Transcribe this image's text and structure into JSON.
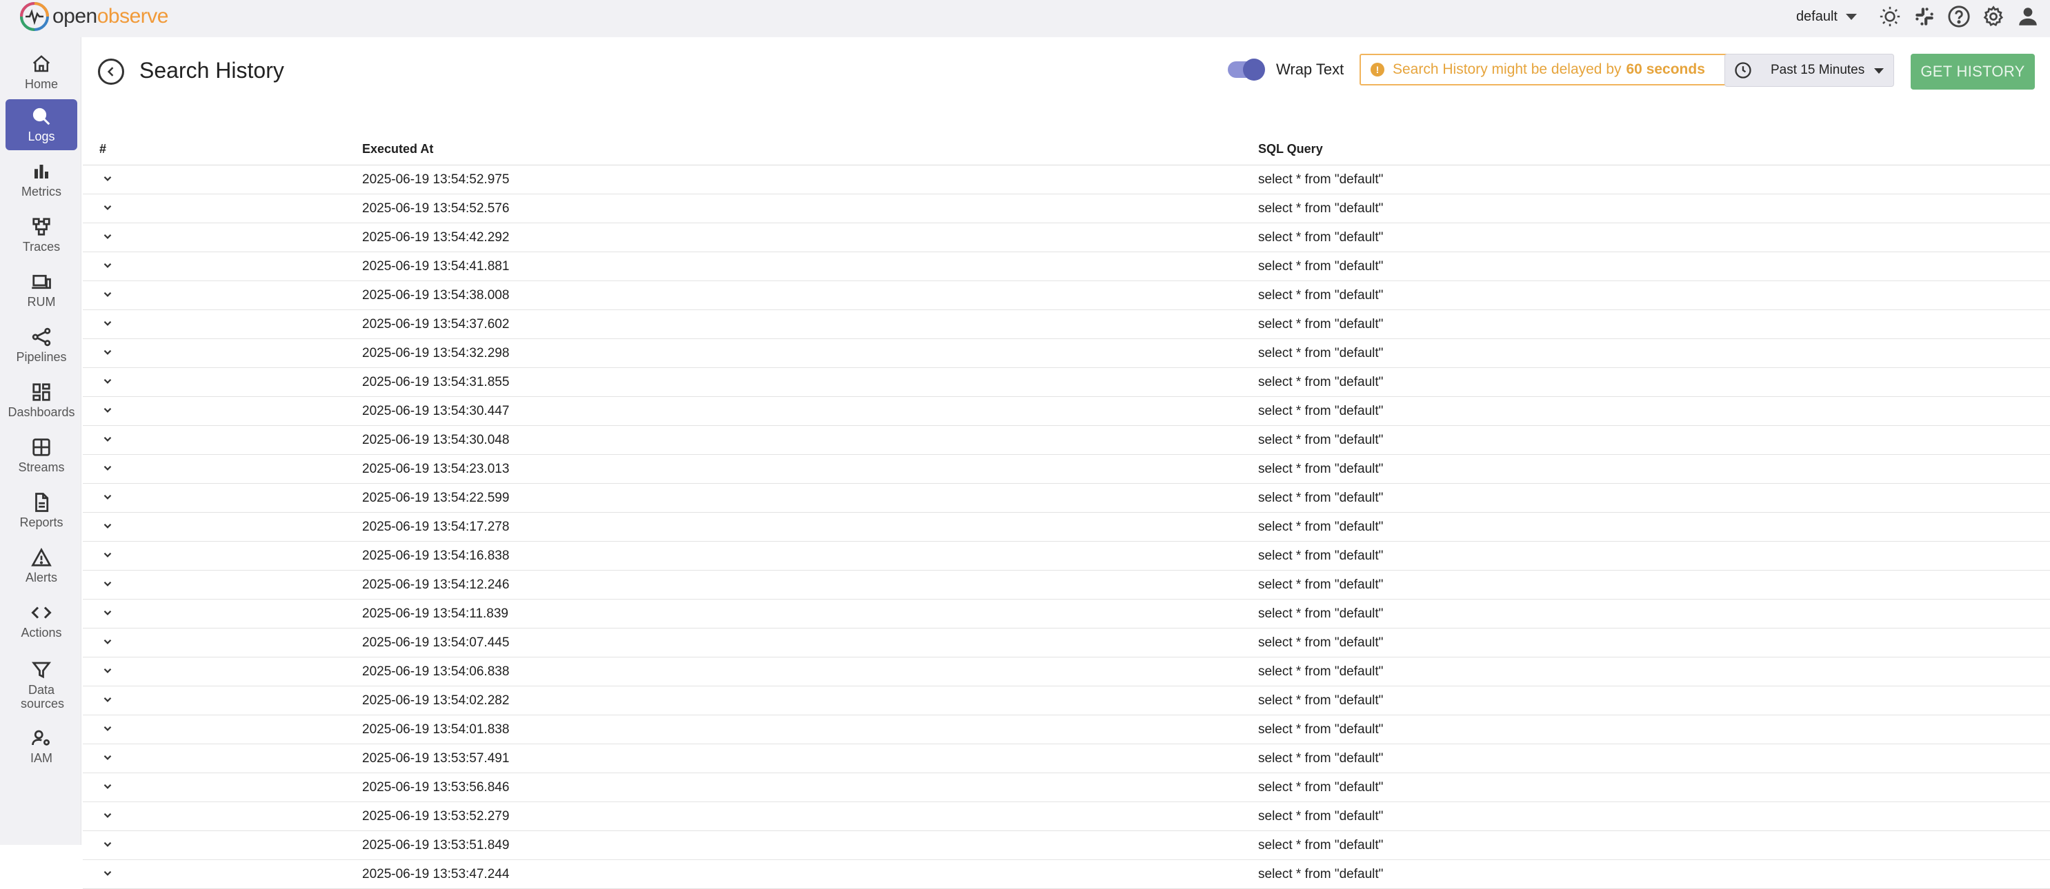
{
  "brand": {
    "name_part1": "open",
    "name_part2": "observe"
  },
  "topbar": {
    "org": "default",
    "icons": [
      "theme-toggle-icon",
      "slack-icon",
      "help-icon",
      "settings-icon",
      "user-icon"
    ]
  },
  "sidebar": {
    "items": [
      {
        "label": "Home",
        "icon": "home-icon"
      },
      {
        "label": "Logs",
        "icon": "search-icon",
        "active": true
      },
      {
        "label": "Metrics",
        "icon": "bar-chart-icon"
      },
      {
        "label": "Traces",
        "icon": "traces-icon"
      },
      {
        "label": "RUM",
        "icon": "devices-icon"
      },
      {
        "label": "Pipelines",
        "icon": "share-icon"
      },
      {
        "label": "Dashboards",
        "icon": "dashboard-icon"
      },
      {
        "label": "Streams",
        "icon": "grid-icon"
      },
      {
        "label": "Reports",
        "icon": "document-icon"
      },
      {
        "label": "Alerts",
        "icon": "warning-icon"
      },
      {
        "label": "Actions",
        "icon": "code-icon"
      },
      {
        "label": "Data sources",
        "icon": "filter-icon"
      },
      {
        "label": "IAM",
        "icon": "manage-accounts-icon"
      }
    ]
  },
  "header": {
    "title": "Search History",
    "wrap_text_label": "Wrap Text",
    "wrap_text_on": true,
    "notice_text": "Search History might be delayed by",
    "notice_bold": "60 seconds",
    "time_range": "Past 15 Minutes",
    "get_history_label": "GET HISTORY"
  },
  "table": {
    "columns": [
      "#",
      "Executed At",
      "SQL Query"
    ],
    "rows": [
      {
        "executed_at": "2025-06-19 13:54:52.975",
        "sql": "select * from \"default\""
      },
      {
        "executed_at": "2025-06-19 13:54:52.576",
        "sql": "select * from \"default\""
      },
      {
        "executed_at": "2025-06-19 13:54:42.292",
        "sql": "select * from \"default\""
      },
      {
        "executed_at": "2025-06-19 13:54:41.881",
        "sql": "select * from \"default\""
      },
      {
        "executed_at": "2025-06-19 13:54:38.008",
        "sql": "select * from \"default\""
      },
      {
        "executed_at": "2025-06-19 13:54:37.602",
        "sql": "select * from \"default\""
      },
      {
        "executed_at": "2025-06-19 13:54:32.298",
        "sql": "select * from \"default\""
      },
      {
        "executed_at": "2025-06-19 13:54:31.855",
        "sql": "select * from \"default\""
      },
      {
        "executed_at": "2025-06-19 13:54:30.447",
        "sql": "select * from \"default\""
      },
      {
        "executed_at": "2025-06-19 13:54:30.048",
        "sql": "select * from \"default\""
      },
      {
        "executed_at": "2025-06-19 13:54:23.013",
        "sql": "select * from \"default\""
      },
      {
        "executed_at": "2025-06-19 13:54:22.599",
        "sql": "select * from \"default\""
      },
      {
        "executed_at": "2025-06-19 13:54:17.278",
        "sql": "select * from \"default\""
      },
      {
        "executed_at": "2025-06-19 13:54:16.838",
        "sql": "select * from \"default\""
      },
      {
        "executed_at": "2025-06-19 13:54:12.246",
        "sql": "select * from \"default\""
      },
      {
        "executed_at": "2025-06-19 13:54:11.839",
        "sql": "select * from \"default\""
      },
      {
        "executed_at": "2025-06-19 13:54:07.445",
        "sql": "select * from \"default\""
      },
      {
        "executed_at": "2025-06-19 13:54:06.838",
        "sql": "select * from \"default\""
      },
      {
        "executed_at": "2025-06-19 13:54:02.282",
        "sql": "select * from \"default\""
      },
      {
        "executed_at": "2025-06-19 13:54:01.838",
        "sql": "select * from \"default\""
      },
      {
        "executed_at": "2025-06-19 13:53:57.491",
        "sql": "select * from \"default\""
      },
      {
        "executed_at": "2025-06-19 13:53:56.846",
        "sql": "select * from \"default\""
      },
      {
        "executed_at": "2025-06-19 13:53:52.279",
        "sql": "select * from \"default\""
      },
      {
        "executed_at": "2025-06-19 13:53:51.849",
        "sql": "select * from \"default\""
      },
      {
        "executed_at": "2025-06-19 13:53:47.244",
        "sql": "select * from \"default\""
      }
    ]
  },
  "colors": {
    "accent": "#5960b2",
    "get_history_bg": "#68b679",
    "notice": "#e6a43c"
  }
}
